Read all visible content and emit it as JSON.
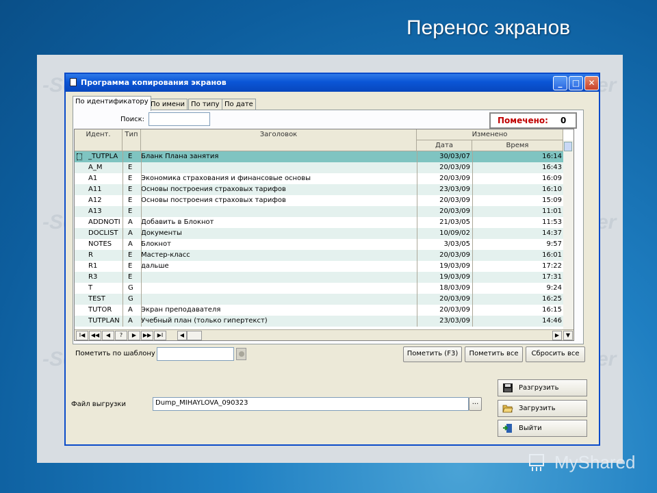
{
  "slide": {
    "title": "Перенос экранов",
    "brand": "MyShared"
  },
  "window": {
    "title": "Программа копирования экранов"
  },
  "tabs": [
    {
      "label": "По идентификатору",
      "active": true
    },
    {
      "label": "По имени",
      "active": false
    },
    {
      "label": "По типу",
      "active": false
    },
    {
      "label": "По дате",
      "active": false
    }
  ],
  "search": {
    "label": "Поиск:",
    "value": ""
  },
  "marked": {
    "label": "Помечено:",
    "count": "0"
  },
  "grid": {
    "headers": {
      "id": "Идент.",
      "type": "Тип",
      "title": "Заголовок",
      "changed": "Изменено",
      "date": "Дата",
      "time": "Время"
    },
    "rows": [
      {
        "id": "_TUTPLA",
        "type": "E",
        "title": "Бланк Плана занятия",
        "date": "30/03/07",
        "time": "16:14",
        "selected": true
      },
      {
        "id": "A_M",
        "type": "E",
        "title": "",
        "date": "20/03/09",
        "time": "16:43"
      },
      {
        "id": "A1",
        "type": "E",
        "title": "Экономика страхования и финансовые основы",
        "date": "20/03/09",
        "time": "16:09"
      },
      {
        "id": "A11",
        "type": "E",
        "title": "Основы построения страховых тарифов",
        "date": "23/03/09",
        "time": "16:10"
      },
      {
        "id": "A12",
        "type": "E",
        "title": "Основы построения страховых тарифов",
        "date": "20/03/09",
        "time": "15:09"
      },
      {
        "id": "A13",
        "type": "E",
        "title": "",
        "date": "20/03/09",
        "time": "11:01"
      },
      {
        "id": "ADDNOTI",
        "type": "A",
        "title": "Добавить в Блокнот",
        "date": "21/03/05",
        "time": "11:53"
      },
      {
        "id": "DOCLIST",
        "type": "A",
        "title": "Документы",
        "date": "10/09/02",
        "time": "14:37"
      },
      {
        "id": "NOTES",
        "type": "A",
        "title": "Блокнот",
        "date": "3/03/05",
        "time": "9:57"
      },
      {
        "id": "R",
        "type": "E",
        "title": "Мастер-класс",
        "date": "20/03/09",
        "time": "16:01"
      },
      {
        "id": "R1",
        "type": "E",
        "title": "дальше",
        "date": "19/03/09",
        "time": "17:22"
      },
      {
        "id": "R3",
        "type": "E",
        "title": "",
        "date": "19/03/09",
        "time": "17:31"
      },
      {
        "id": "T",
        "type": "G",
        "title": "",
        "date": "18/03/09",
        "time": "9:24"
      },
      {
        "id": "TEST",
        "type": "G",
        "title": "",
        "date": "20/03/09",
        "time": "16:25"
      },
      {
        "id": "TUTOR",
        "type": "A",
        "title": "Экран преподавателя",
        "date": "20/03/09",
        "time": "16:15"
      },
      {
        "id": "TUTPLAN",
        "type": "A",
        "title": "Учебный план (только гипертекст)",
        "date": "23/03/09",
        "time": "14:46"
      }
    ],
    "nav": [
      "I◀",
      "◀◀",
      "◀",
      "?",
      "▶",
      "▶▶",
      "▶I"
    ]
  },
  "template": {
    "label": "Пометить по шаблону",
    "value": ""
  },
  "buttons": {
    "mark": "Пометить (F3)",
    "mark_all": "Пометить все",
    "reset_all": "Сбросить все"
  },
  "export": {
    "label": "Файл выгрузки",
    "value": "Dump_MIHAYLOVA_090323",
    "browse": "..."
  },
  "actions": {
    "unload": "Разгрузить",
    "load": "Загрузить",
    "exit": "Выйти"
  },
  "colors": {
    "title_bar": "#0a55d6",
    "selected_row": "#7fc4c1",
    "marked_label": "#c00000"
  }
}
